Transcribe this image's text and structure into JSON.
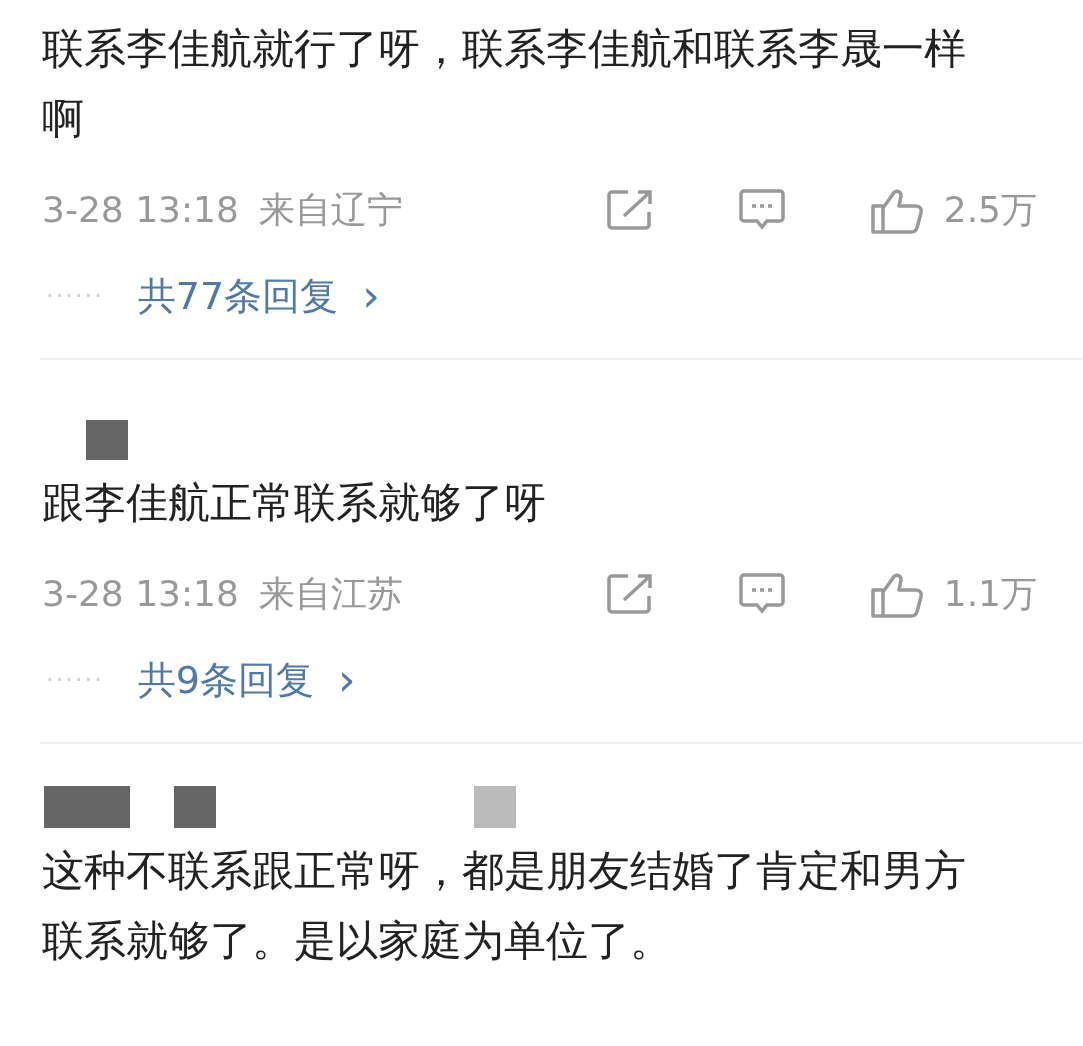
{
  "comments": [
    {
      "text": "联系李佳航就行了呀，联系李佳航和联系李晟一样啊",
      "time": "3-28 13:18",
      "location": "来自辽宁",
      "likes": "2.5万",
      "dots": "······",
      "replies": "共77条回复",
      "chevron": "›"
    },
    {
      "text": "跟李佳航正常联系就够了呀",
      "time": "3-28 13:18",
      "location": "来自江苏",
      "likes": "1.1万",
      "dots": "······",
      "replies": "共9条回复",
      "chevron": "›"
    },
    {
      "text": "这种不联系跟正常呀，都是朋友结婚了肯定和男方联系就够了。是以家庭为单位了。"
    }
  ]
}
